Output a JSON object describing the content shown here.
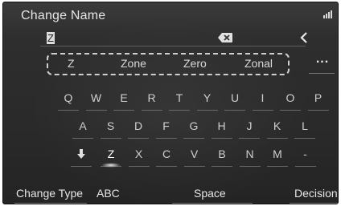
{
  "header": {
    "title": "Change Name"
  },
  "input": {
    "value": "Z"
  },
  "suggestions": [
    "Z",
    "Zone",
    "Zero",
    "Zonal"
  ],
  "more_label": "...",
  "keyboard": {
    "row1": [
      "Q",
      "W",
      "E",
      "R",
      "T",
      "Y",
      "U",
      "I",
      "O",
      "P"
    ],
    "row2": [
      "A",
      "S",
      "D",
      "F",
      "G",
      "H",
      "J",
      "K",
      "L"
    ],
    "row3": [
      "Z",
      "X",
      "C",
      "V",
      "B",
      "N",
      "M",
      "-"
    ],
    "active_key": "Z"
  },
  "bottom": {
    "change_type": "Change Type",
    "abc": "ABC",
    "space": "Space",
    "decision": "Decision"
  },
  "icons": {
    "shift": "shift-down-arrow-icon",
    "backspace": "backspace-icon",
    "back": "back-chevron-icon",
    "signal": "signal-strength-icon"
  }
}
